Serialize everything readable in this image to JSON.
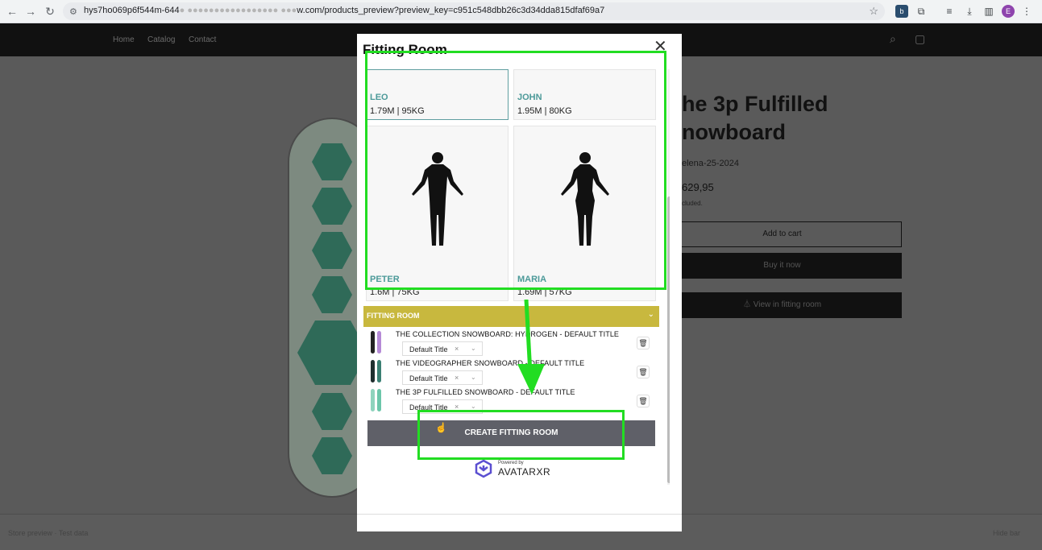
{
  "browser": {
    "url": "hys7ho069p6f544m-644",
    "url_tail": "w.com/products_preview?preview_key=c951c548dbb26c3d34dda815dfaf69a7",
    "profile_initial": "E"
  },
  "shop": {
    "nav": [
      "Home",
      "Catalog",
      "Contact"
    ],
    "product_title_line1": "he 3p Fulfilled",
    "product_title_line2": "nowboard",
    "vendor": "elena-25-2024",
    "price": "629,95",
    "tax_note": "cluded.",
    "add_to_cart": "Add to cart",
    "buy_now": "Buy it now",
    "view_fitting": "View in fitting room",
    "footer_left": "Store preview · Test data",
    "footer_right": "Hide bar"
  },
  "modal": {
    "title": "Fitting Room",
    "avatars": [
      {
        "name": "LEO",
        "meta": "1.79M | 95KG"
      },
      {
        "name": "JOHN",
        "meta": "1.95M | 80KG"
      },
      {
        "name": "PETER",
        "meta": "1.6M | 75KG"
      },
      {
        "name": "MARIA",
        "meta": "1.69M | 57KG"
      }
    ],
    "accordion_label": "FITTING ROOM",
    "items": [
      {
        "title": "THE COLLECTION SNOWBOARD: HYDROGEN - DEFAULT TITLE",
        "variant": "Default Title"
      },
      {
        "title": "THE VIDEOGRAPHER SNOWBOARD - DEFAULT TITLE",
        "variant": "Default Title"
      },
      {
        "title": "THE 3P FULFILLED SNOWBOARD - DEFAULT TITLE",
        "variant": "Default Title"
      }
    ],
    "create_button": "CREATE FITTING ROOM",
    "powered_by": "Powered by",
    "brand": "AVATARXR"
  },
  "colors": {
    "accent_gold": "#c8b83e",
    "avatar_name": "#4c9a99",
    "annotation_green": "#22dd22"
  }
}
